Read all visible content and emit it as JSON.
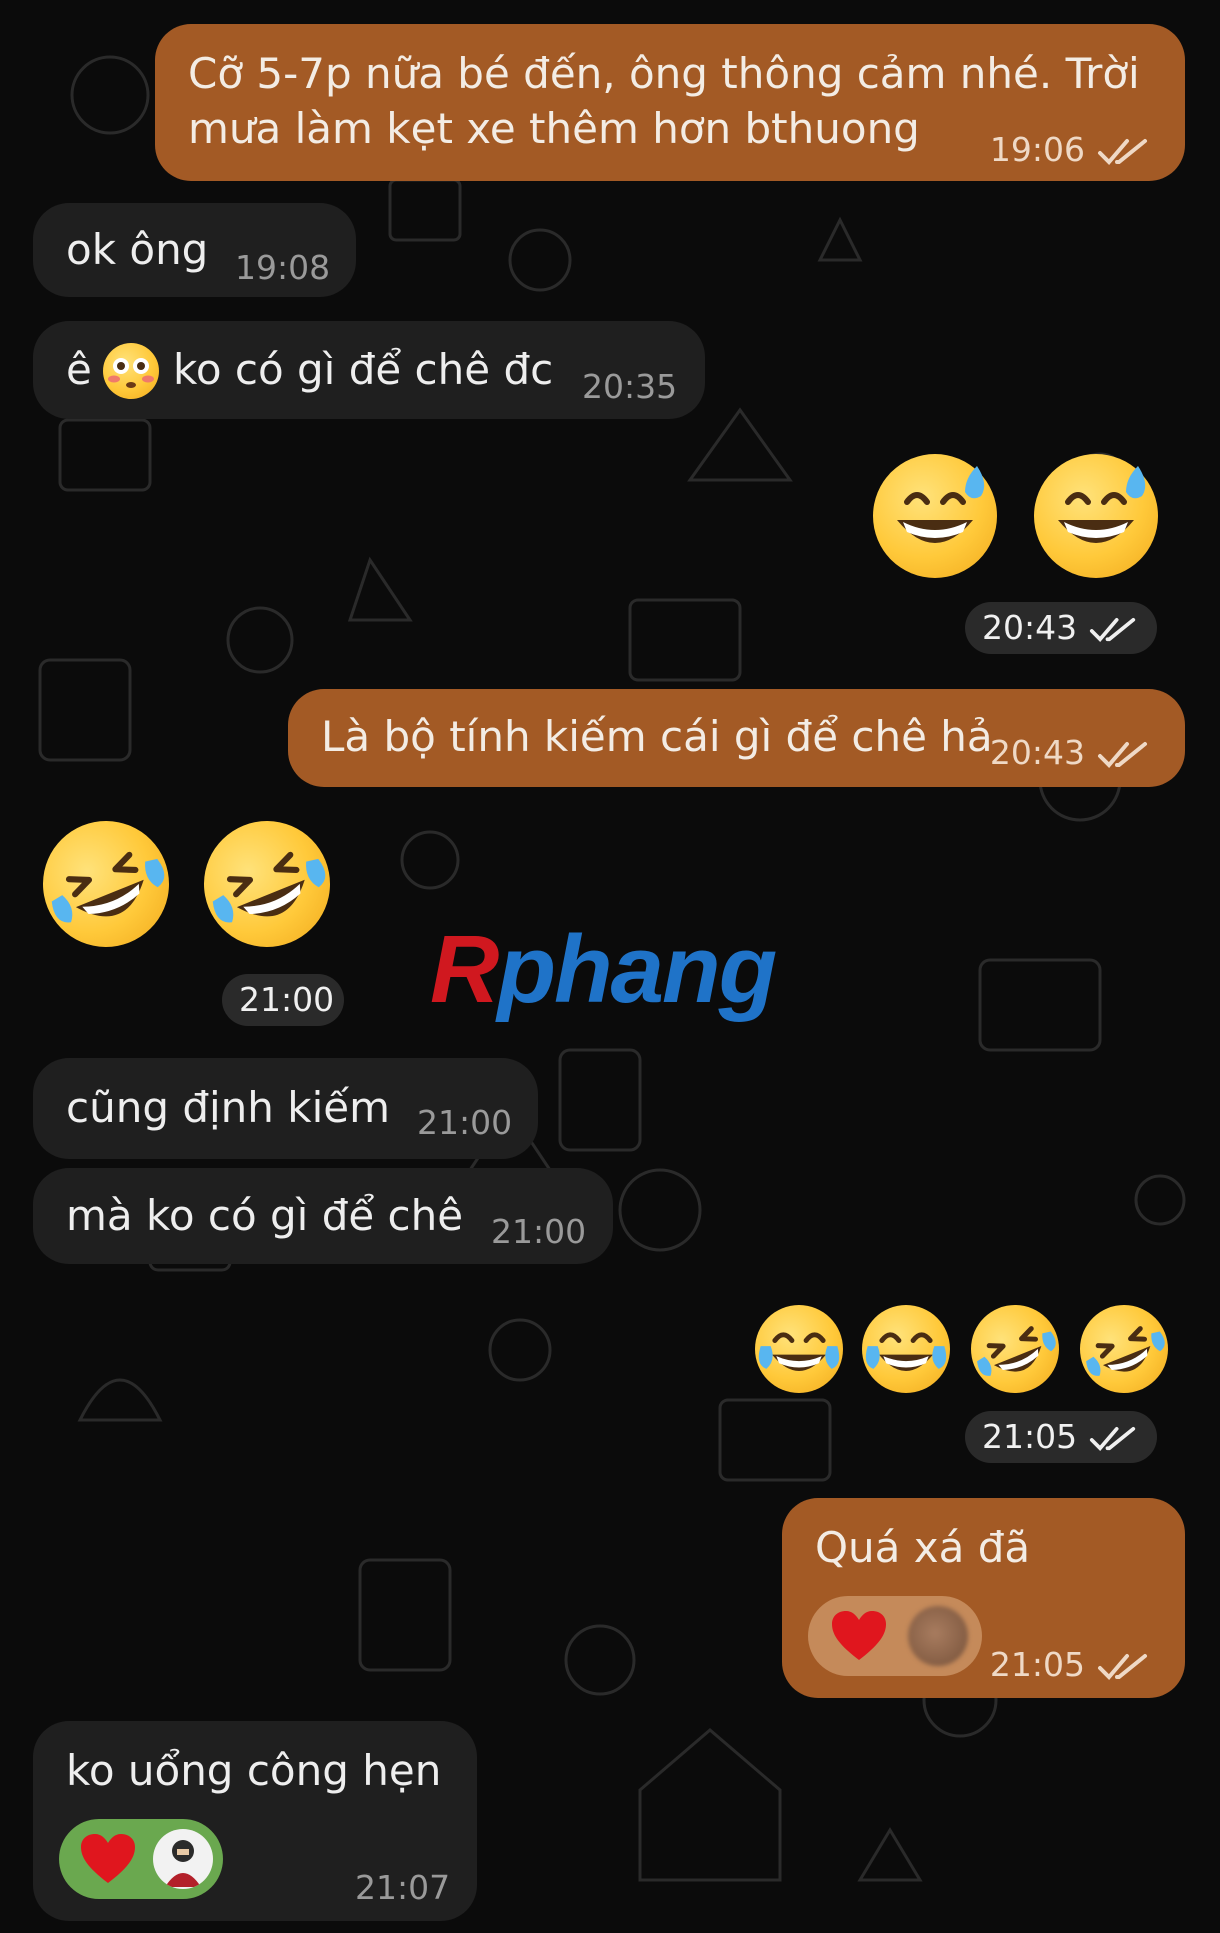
{
  "watermark": {
    "first": "R",
    "rest": "phang"
  },
  "messages": [
    {
      "dir": "out",
      "line1": "Cỡ 5-7p nữa bé đến, ông thông cảm nhé. Trời",
      "line2": "mưa làm kẹt xe thêm hơn bthuong",
      "time": "19:06"
    },
    {
      "dir": "in",
      "text": "ok ông",
      "time": "19:08"
    },
    {
      "dir": "in",
      "text_before": "ê",
      "emoji": "flushed-face",
      "text_after": "ko có gì để chê đc",
      "time": "20:35"
    },
    {
      "dir": "out",
      "emojis": [
        "grinning-sweat",
        "grinning-sweat"
      ],
      "time": "20:43"
    },
    {
      "dir": "out",
      "text": "Là bộ tính kiếm cái gì để chê hả",
      "time": "20:43"
    },
    {
      "dir": "in",
      "emojis": [
        "rolling-on-floor-laughing",
        "rolling-on-floor-laughing"
      ],
      "time": "21:00"
    },
    {
      "dir": "in",
      "text": "cũng định kiếm",
      "time": "21:00"
    },
    {
      "dir": "in",
      "text": "mà ko có gì để chê",
      "time": "21:00"
    },
    {
      "dir": "out",
      "emojis": [
        "tears-of-joy",
        "tears-of-joy",
        "rolling-on-floor-laughing",
        "rolling-on-floor-laughing"
      ],
      "time": "21:05"
    },
    {
      "dir": "out",
      "text": "Quá xá đã",
      "reaction": "red-heart",
      "time": "21:05"
    },
    {
      "dir": "in",
      "text": "ko uổng công hẹn",
      "reaction": "red-heart",
      "time": "21:07"
    }
  ],
  "colors": {
    "background": "#0b0b0b",
    "outgoing_bubble": "#a35a25",
    "incoming_bubble": "#1f1f1f",
    "reaction_pill_in": "#6aa84f",
    "watermark_red": "#d0181f",
    "watermark_blue": "#1f73c8"
  }
}
